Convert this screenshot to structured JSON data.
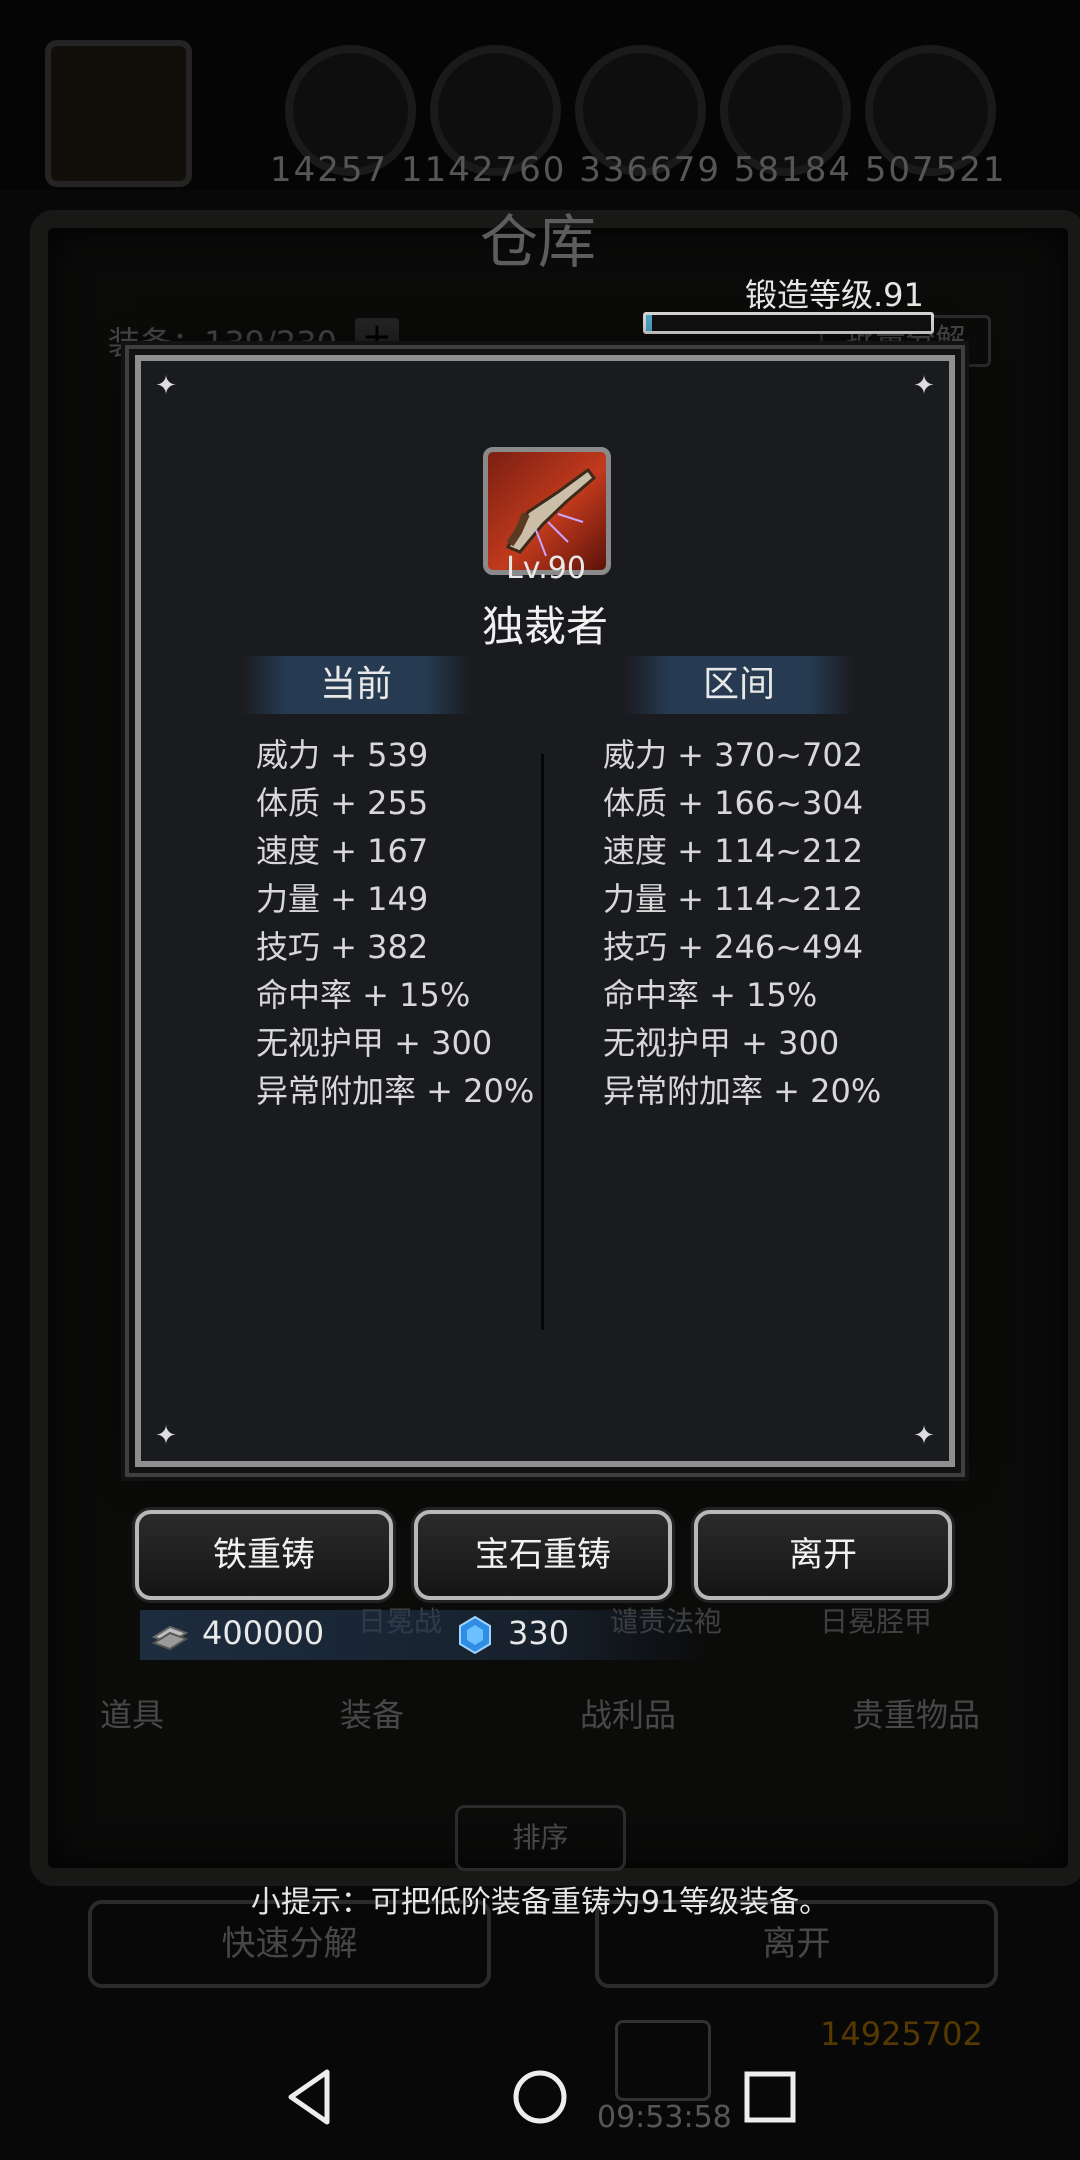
{
  "background": {
    "top_numbers": "14257 1142760 336679 58184 507521",
    "title": "仓库",
    "capacity": "装备：139/230",
    "plus": "+",
    "batch_label": "批量分解",
    "tabs": [
      "道具",
      "装备",
      "战利品",
      "贵重物品"
    ],
    "sort_label": "排序",
    "quick_decompose": "快速分解",
    "leave": "离开",
    "slot_labels": [
      "日冕战",
      "谴责法袍",
      "日冕胫甲"
    ],
    "gold": "14925702",
    "time": "09:53:58"
  },
  "forge": {
    "label": "锻造等级.91",
    "progress_fraction": 0.02
  },
  "modal": {
    "item_level": "Lv.90",
    "item_name": "独裁者",
    "current_header": "当前",
    "range_header": "区间",
    "current_stats": [
      "威力 + 539",
      "体质 + 255",
      "速度 + 167",
      "力量 + 149",
      "技巧 + 382",
      "命中率 + 15%",
      "无视护甲 + 300",
      "异常附加率 + 20%"
    ],
    "range_stats": [
      "威力 + 370~702",
      "体质 + 166~304",
      "速度 + 114~212",
      "力量 + 114~212",
      "技巧 + 246~494",
      "命中率 + 15%",
      "无视护甲 + 300",
      "异常附加率 + 20%"
    ]
  },
  "actions": {
    "iron_recast": "铁重铸",
    "gem_recast": "宝石重铸",
    "leave": "离开"
  },
  "currency": {
    "iron": "400000",
    "gem": "330"
  },
  "tip": "小提示：可把低阶装备重铸为91等级装备。",
  "colors": {
    "accent": "#4fa6c7",
    "item_bg": "#c23a1d"
  }
}
